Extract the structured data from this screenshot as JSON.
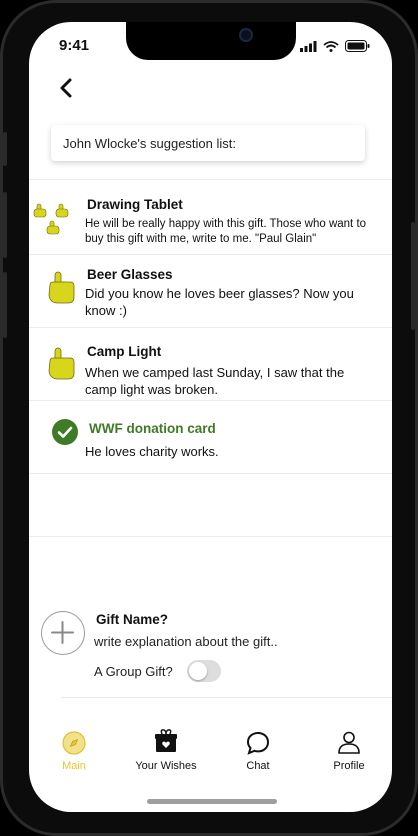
{
  "status": {
    "time": "9:41"
  },
  "header": {
    "suggestion_title": "John Wlocke's suggestion list:"
  },
  "items": [
    {
      "title": "Drawing Tablet",
      "description": "He will be really happy with this gift. Those who want to buy this gift with me, write to me. \"Paul Glain\"",
      "icon": "group-pointing-hands-icon",
      "status": "group"
    },
    {
      "title": "Beer Glasses",
      "description": "Did you know he loves beer glasses? Now you know :)",
      "icon": "pointing-hand-icon",
      "status": "open"
    },
    {
      "title": "Camp Light",
      "description": "When we camped last Sunday, I saw that the camp light was broken.",
      "icon": "pointing-hand-icon",
      "status": "open"
    },
    {
      "title": "WWF donation card",
      "description": "He loves charity works.",
      "icon": "check-circle-icon",
      "status": "done"
    }
  ],
  "add_gift": {
    "name_label": "Gift Name?",
    "explanation_placeholder": "write explanation about the gift..",
    "group_gift_label": "A Group Gift?",
    "group_gift_enabled": false
  },
  "tabs": [
    {
      "label": "Main",
      "icon": "main-compass-icon",
      "active": true
    },
    {
      "label": "Your Wishes",
      "icon": "gift-box-icon",
      "active": false
    },
    {
      "label": "Chat",
      "icon": "chat-bubble-icon",
      "active": false
    },
    {
      "label": "Profile",
      "icon": "person-icon",
      "active": false
    }
  ],
  "colors": {
    "accent": "#e8c52d",
    "hand": "#d8d61c",
    "check": "#3f7b27",
    "donation_title": "#3f7b27"
  }
}
